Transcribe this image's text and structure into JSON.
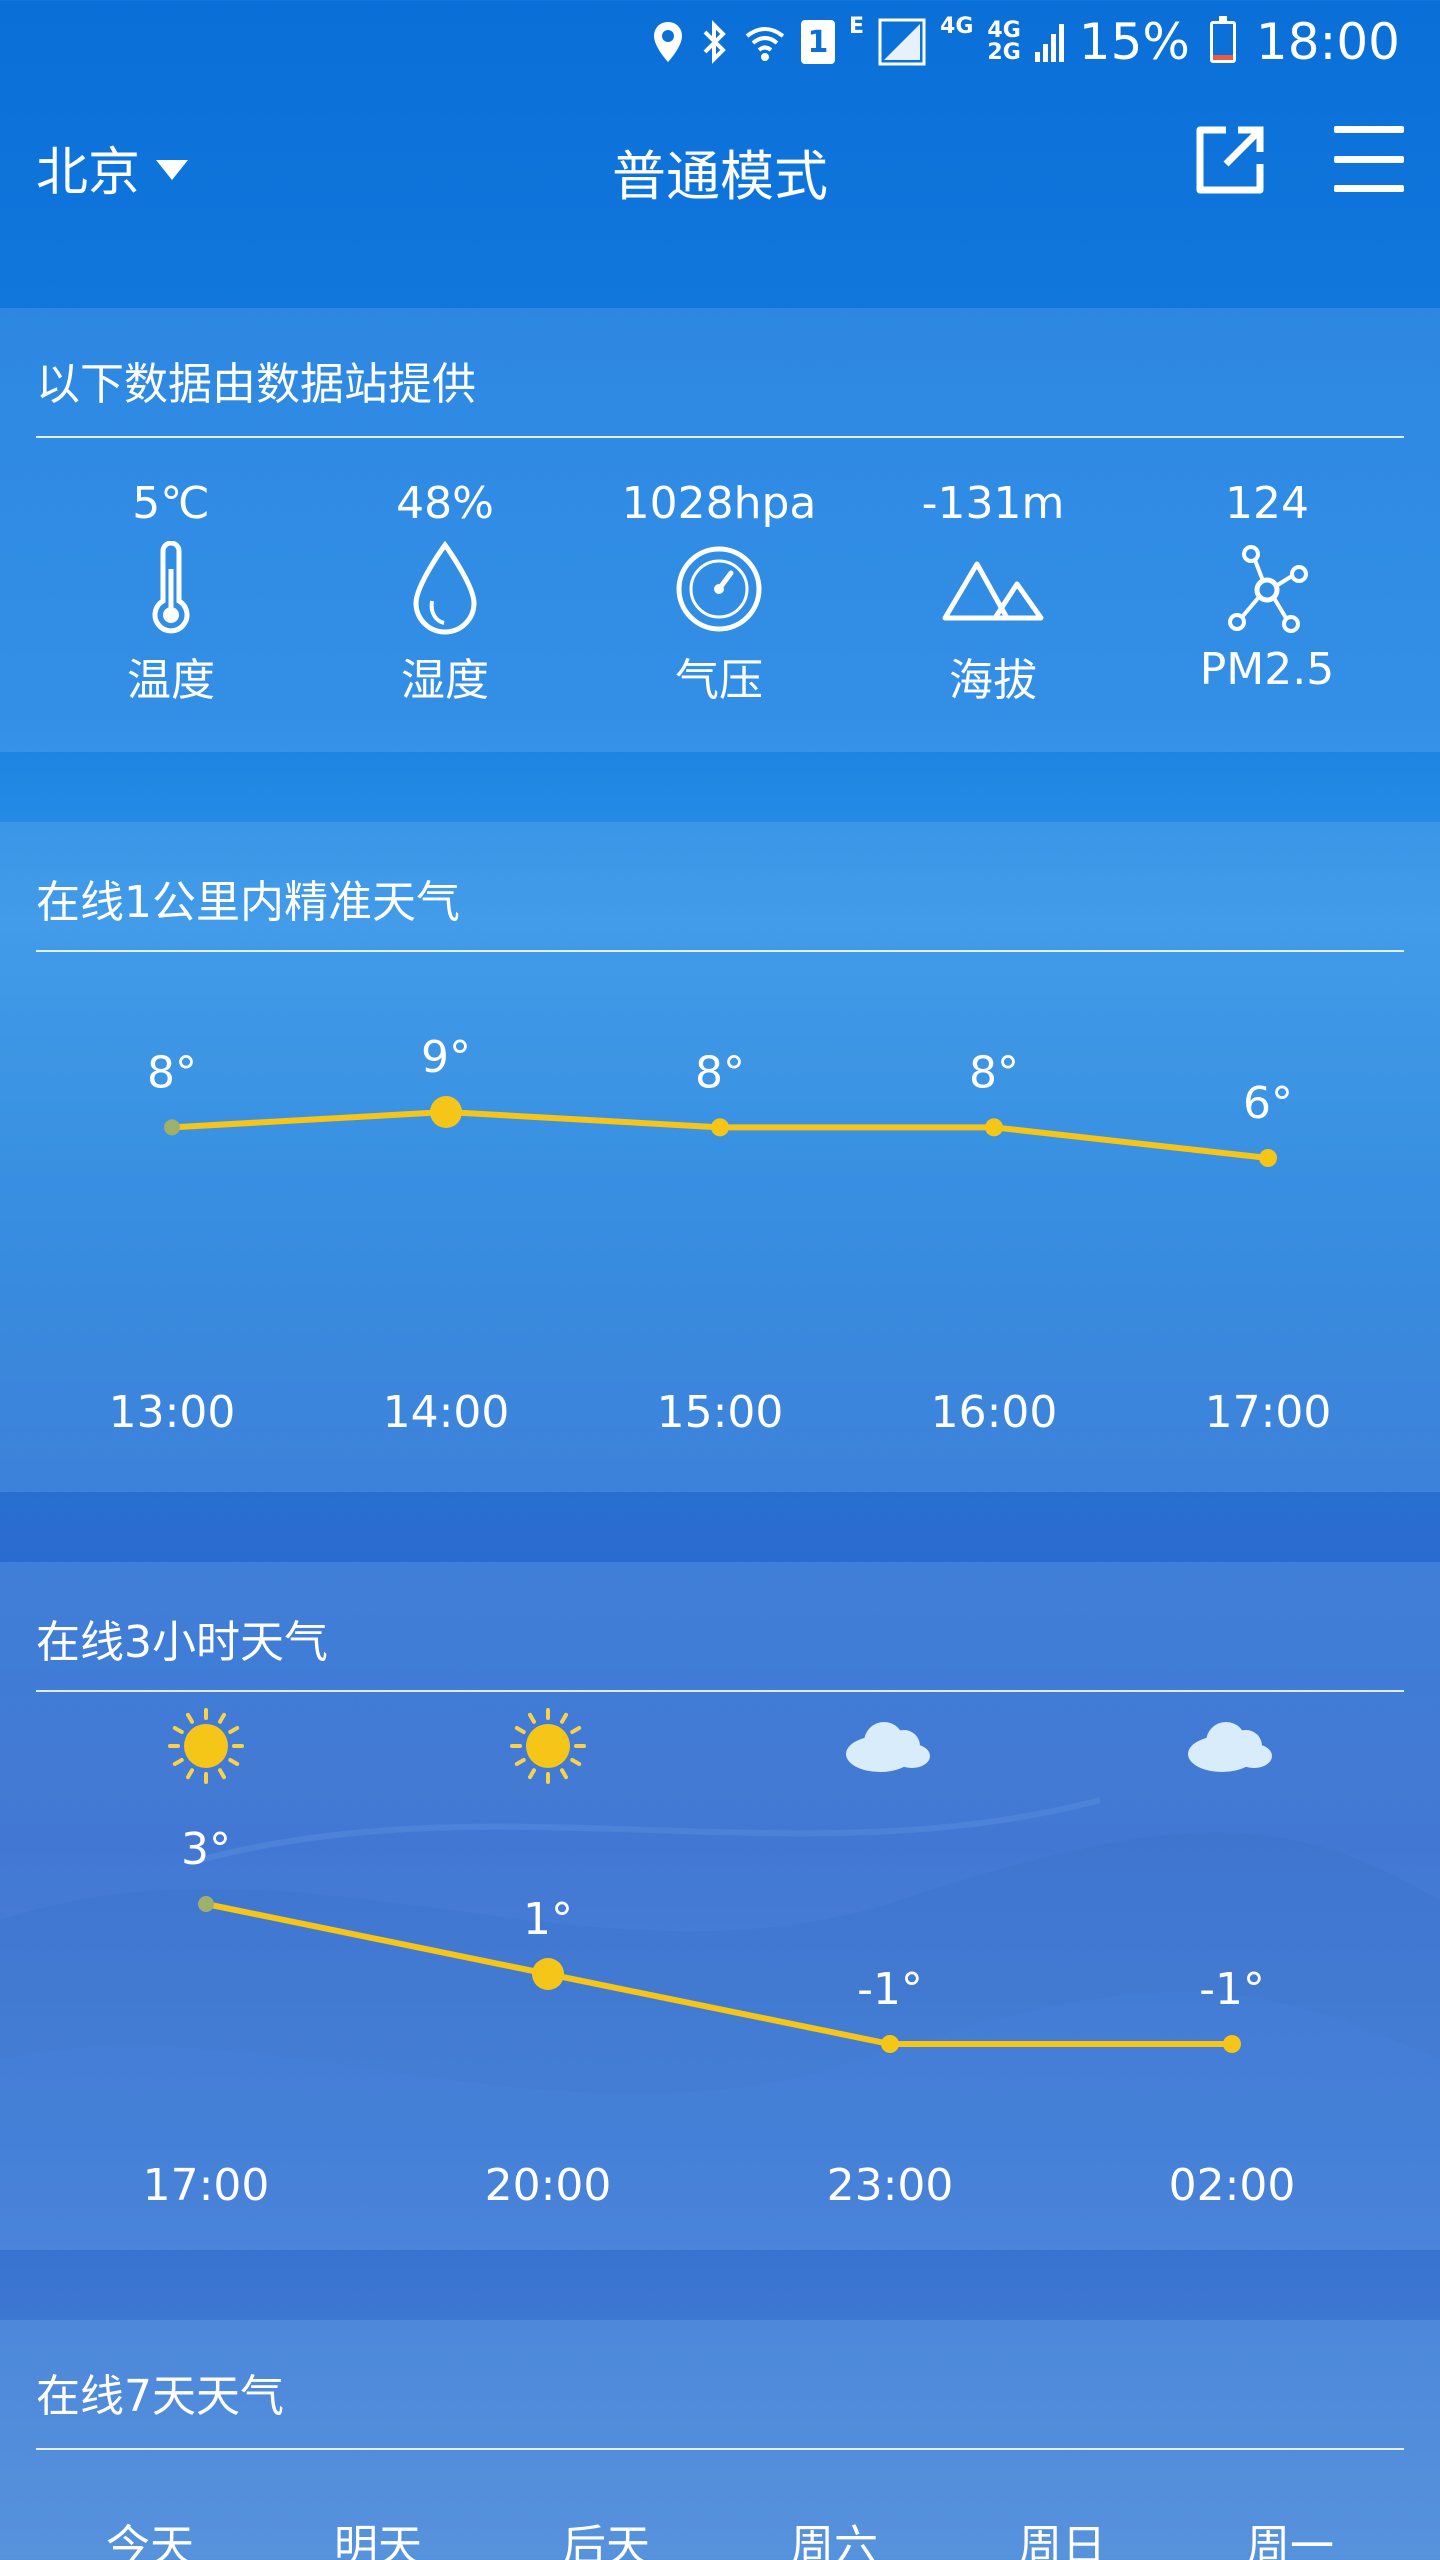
{
  "status_bar": {
    "sim_slot": "1",
    "network_e": "E",
    "network_4g": "4G",
    "network_4g2g_top": "4G",
    "network_4g2g_bottom": "2G",
    "battery_percent": "15%",
    "battery_level": 0.15,
    "time": "18:00"
  },
  "header": {
    "city": "北京",
    "mode": "普通模式"
  },
  "station": {
    "title": "以下数据由数据站提供",
    "items": [
      {
        "value": "5℃",
        "label": "温度",
        "icon": "thermometer-icon"
      },
      {
        "value": "48%",
        "label": "湿度",
        "icon": "droplet-icon"
      },
      {
        "value": "1028hpa",
        "label": "气压",
        "icon": "gauge-icon"
      },
      {
        "value": "-131m",
        "label": "海拔",
        "icon": "mountain-icon"
      },
      {
        "value": "124",
        "label": "PM2.5",
        "icon": "molecule-icon"
      }
    ]
  },
  "hourly_1km": {
    "title": "在线1公里内精准天气"
  },
  "hourly_3h": {
    "title": "在线3小时天气"
  },
  "week": {
    "title": "在线7天天气",
    "days": [
      "今天",
      "明天",
      "后天",
      "周六",
      "周日",
      "周一"
    ]
  },
  "chart_data": [
    {
      "type": "line",
      "x": [
        "13:00",
        "14:00",
        "15:00",
        "16:00",
        "17:00"
      ],
      "series": [
        {
          "values": [
            8,
            9,
            8,
            8,
            6
          ],
          "labels": [
            "8°",
            "9°",
            "8°",
            "8°",
            "6°"
          ]
        }
      ],
      "highlight_index": 1,
      "color": "#f5c518"
    },
    {
      "type": "line",
      "x": [
        "17:00",
        "20:00",
        "23:00",
        "02:00"
      ],
      "icons": [
        "sun-icon",
        "sun-icon",
        "cloud-icon",
        "cloud-icon"
      ],
      "series": [
        {
          "values": [
            3,
            1,
            -1,
            -1
          ],
          "labels": [
            "3°",
            "1°",
            "-1°",
            "-1°"
          ]
        }
      ],
      "highlight_index": 1,
      "color": "#f5c518"
    }
  ]
}
